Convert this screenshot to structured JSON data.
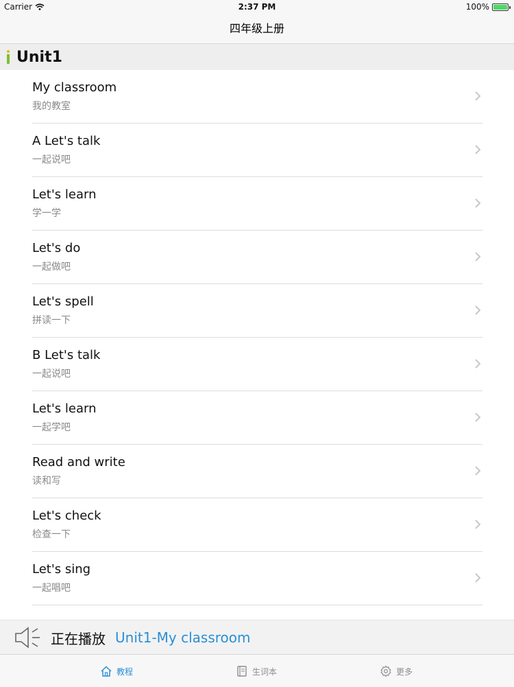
{
  "status_bar": {
    "carrier": "Carrier",
    "time": "2:37 PM",
    "battery": "100%",
    "icons": {
      "wifi": "wifi-icon",
      "battery": "battery-icon"
    }
  },
  "nav": {
    "title": "四年级上册"
  },
  "section": {
    "title": "Unit1"
  },
  "items": [
    {
      "title": "My classroom",
      "subtitle": "我的教室"
    },
    {
      "title": "A Let's talk",
      "subtitle": "一起说吧"
    },
    {
      "title": "Let's learn",
      "subtitle": "学一学"
    },
    {
      "title": "Let's do",
      "subtitle": "一起做吧"
    },
    {
      "title": "Let's spell",
      "subtitle": "拼读一下"
    },
    {
      "title": "B Let's talk",
      "subtitle": "一起说吧"
    },
    {
      "title": "Let's learn",
      "subtitle": "一起学吧"
    },
    {
      "title": "Read and write",
      "subtitle": "读和写"
    },
    {
      "title": "Let's check",
      "subtitle": "检查一下"
    },
    {
      "title": "Let's sing",
      "subtitle": "一起唱吧"
    }
  ],
  "now_playing": {
    "label": "正在播放",
    "track": "Unit1-My classroom"
  },
  "tabs": [
    {
      "label": "教程",
      "icon": "home-icon",
      "active": true
    },
    {
      "label": "生词本",
      "icon": "book-icon",
      "active": false
    },
    {
      "label": "更多",
      "icon": "gear-icon",
      "active": false
    }
  ],
  "colors": {
    "accent": "#2a8fd6",
    "marker_green": "#7cbf36",
    "marker_yellow": "#e6b800"
  }
}
